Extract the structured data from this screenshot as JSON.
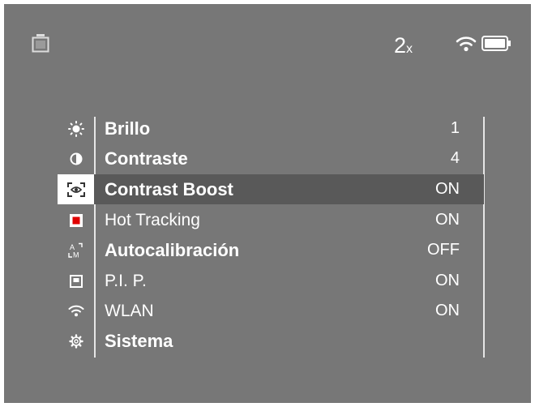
{
  "status_bar": {
    "zoom_value": "2",
    "zoom_suffix": "x"
  },
  "menu": {
    "items": [
      {
        "label": "Brillo",
        "value": "1",
        "icon": "sun-icon",
        "bold": true
      },
      {
        "label": "Contraste",
        "value": "4",
        "icon": "contrast-icon",
        "bold": true
      },
      {
        "label": "Contrast Boost",
        "value": "ON",
        "icon": "eye-focus-icon",
        "bold": true,
        "selected": true
      },
      {
        "label": "Hot Tracking",
        "value": "ON",
        "icon": "hot-tracking-icon",
        "bold": false
      },
      {
        "label": "Autocalibración",
        "value": "OFF",
        "icon": "auto-manual-icon",
        "bold": true
      },
      {
        "label": "P.I. P.",
        "value": "ON",
        "icon": "pip-icon",
        "bold": false
      },
      {
        "label": "WLAN",
        "value": "ON",
        "icon": "wifi-icon",
        "bold": false
      },
      {
        "label": "Sistema",
        "value": "",
        "icon": "gear-icon",
        "bold": true
      }
    ]
  },
  "colors": {
    "background": "#777777",
    "selected_row": "#595959",
    "hot_tracking_red": "#e00000",
    "text": "#ffffff"
  }
}
